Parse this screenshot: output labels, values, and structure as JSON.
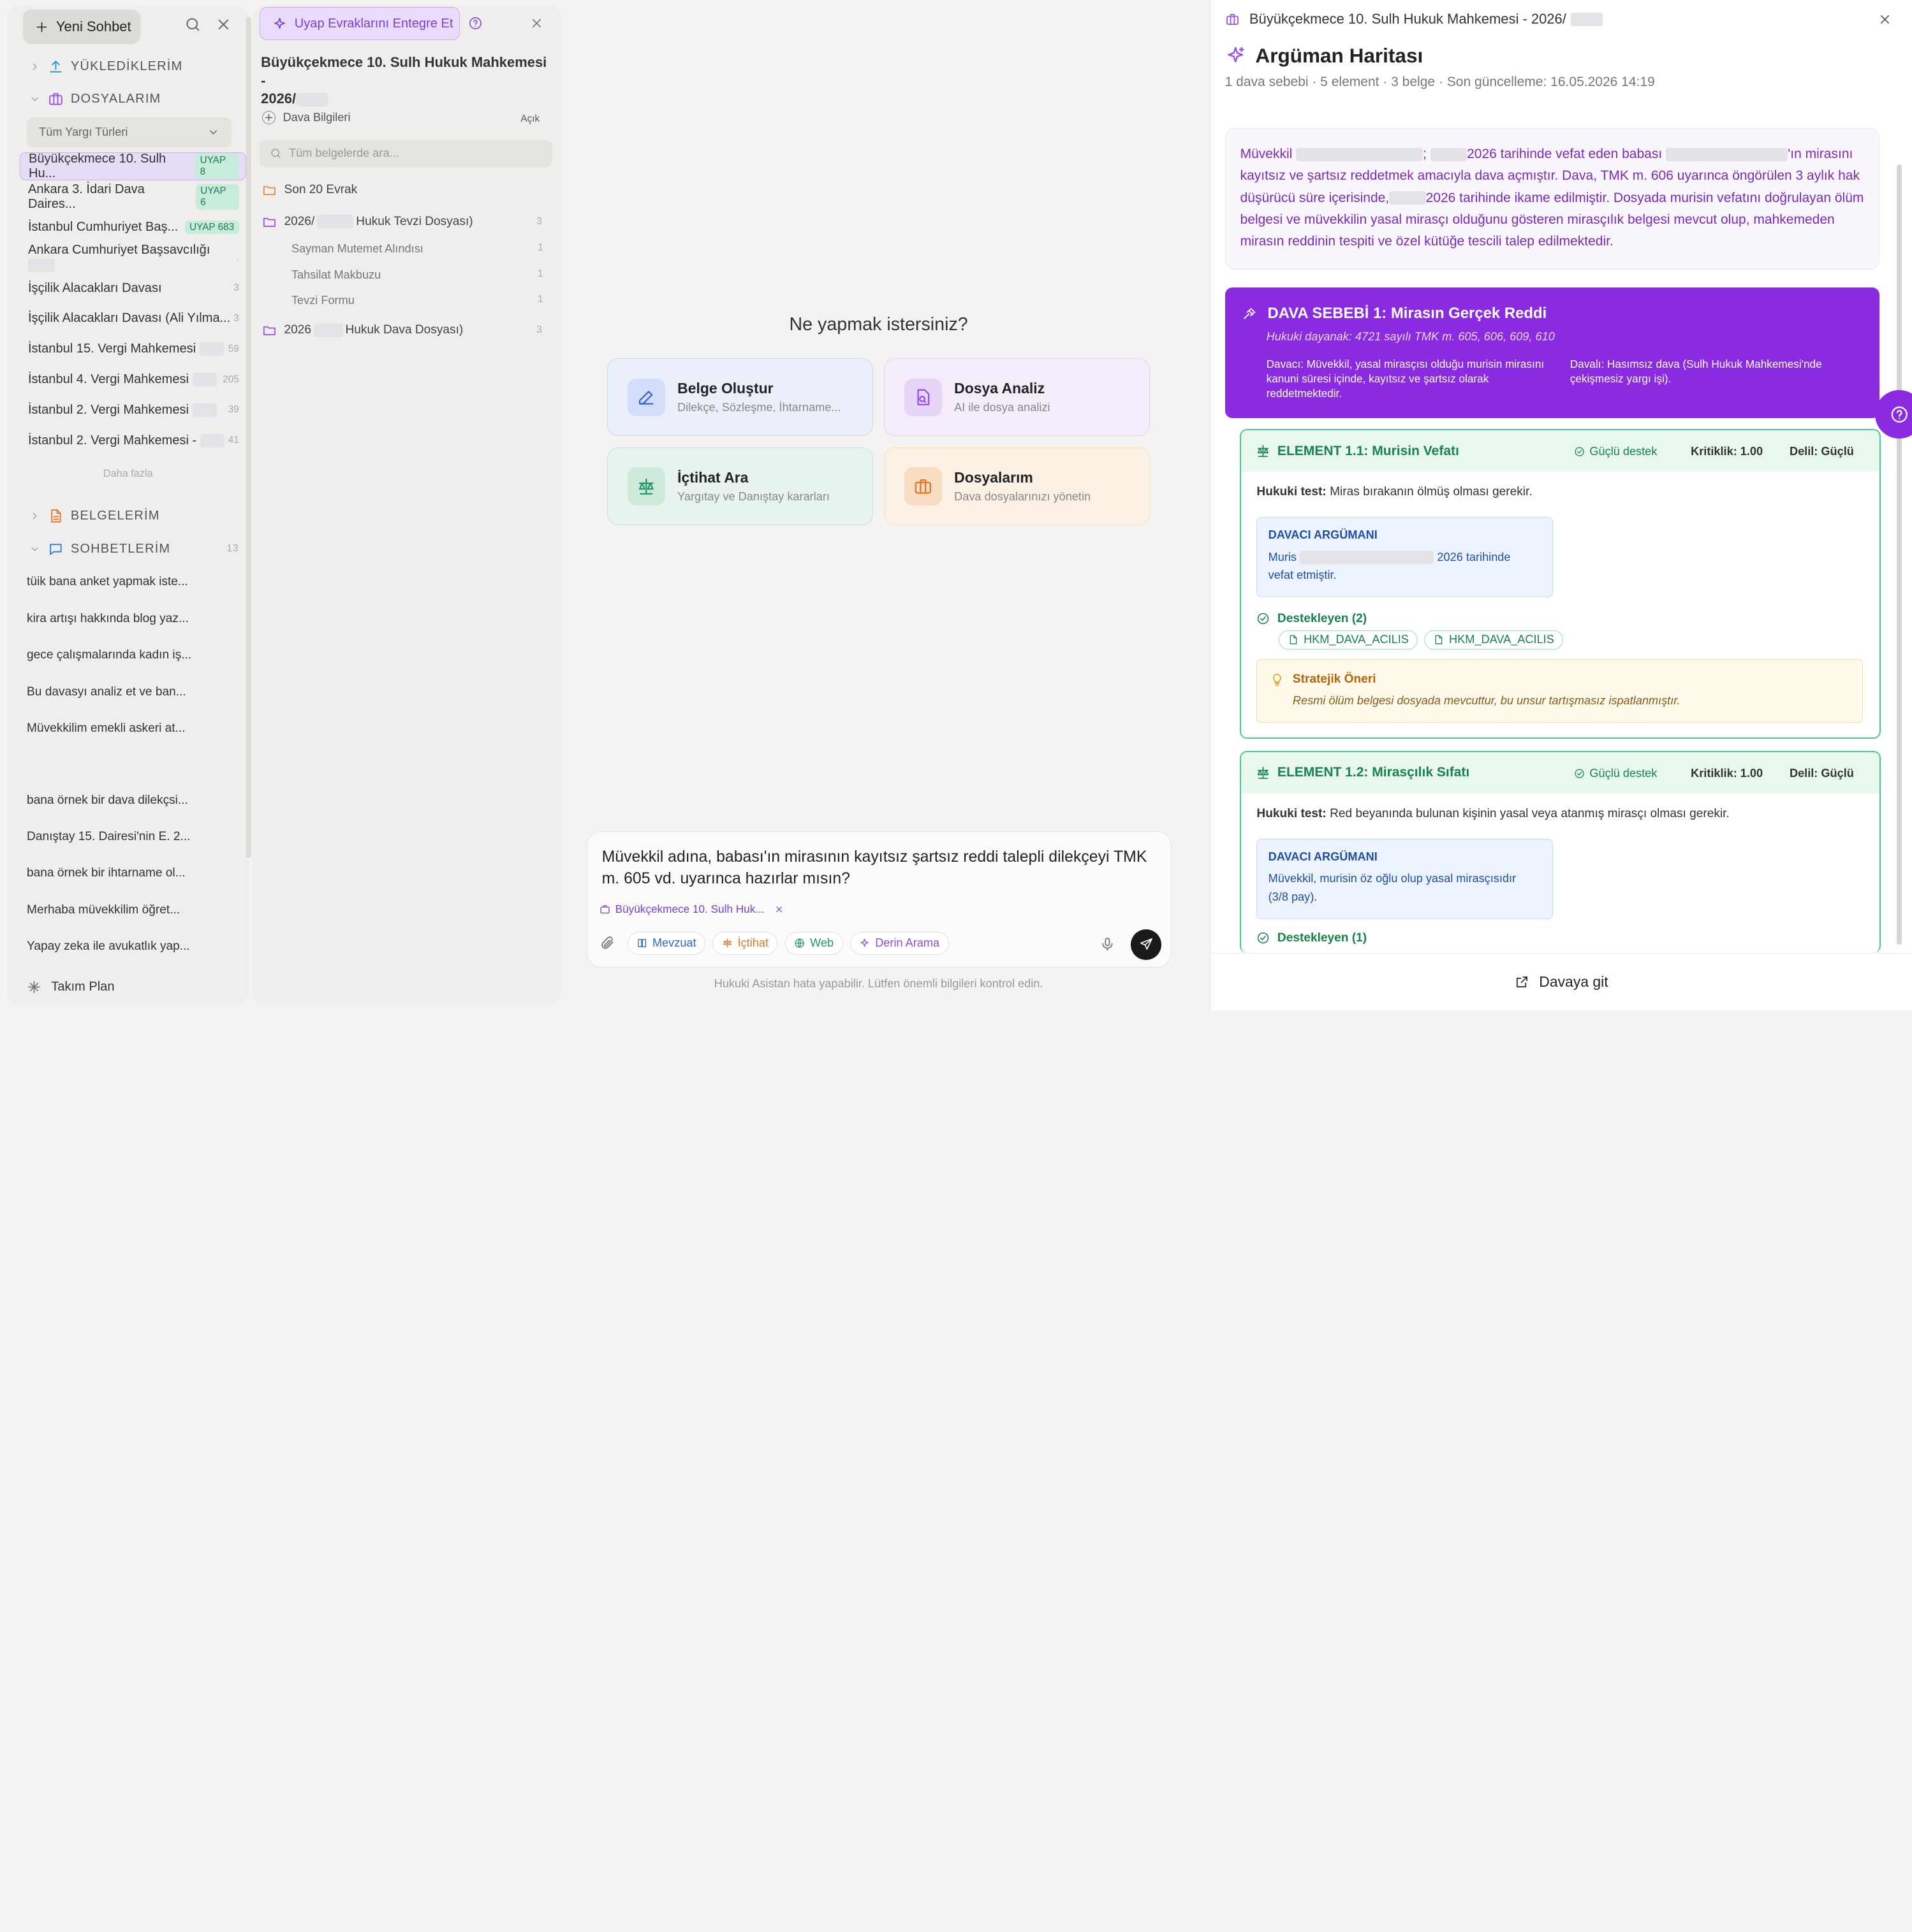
{
  "sidebar": {
    "new_chat": "Yeni Sohbet",
    "uploads": "YÜKLEDİKLERİM",
    "cases": "DOSYALARIM",
    "filter": "Tüm Yargı Türleri",
    "case_items": [
      {
        "label": "Büyükçekmece 10. Sulh Hu...",
        "badge": "UYAP 8"
      },
      {
        "label": "Ankara 3. İdari Dava Daires...",
        "badge": "UYAP 6"
      },
      {
        "label": "İstanbul Cumhuriyet Baş...",
        "badge": "UYAP 683"
      },
      {
        "label": "Ankara Cumhuriyet Başsavcılığı",
        "count": ""
      },
      {
        "label": "İşçilik Alacakları Davası",
        "count": "3"
      },
      {
        "label": "İşçilik Alacakları Davası (Ali Yılma...",
        "count": "3"
      },
      {
        "label": "İstanbul 15. Vergi Mahkemesi",
        "count": "59"
      },
      {
        "label": "İstanbul 4. Vergi Mahkemesi",
        "count": "205"
      },
      {
        "label": "İstanbul 2. Vergi Mahkemesi",
        "count": "39"
      },
      {
        "label": "İstanbul 2. Vergi Mahkemesi -",
        "count": "41"
      }
    ],
    "more": "Daha fazla",
    "documents": "BELGELERİM",
    "chats_title": "SOHBETLERİM",
    "chats_count": "13",
    "chats": [
      "tüik bana anket yapmak iste...",
      "kira artışı hakkında blog yaz...",
      "gece çalışmalarında kadın iş...",
      "Bu davasyı analiz et ve ban...",
      "Müvekkilim emekli askeri at...",
      "bana örnek bir dava dilekçsi...",
      "Danıştay 15. Dairesi'nin E. 2...",
      "bana örnek bir ihtarname ol...",
      "Merhaba müvekkilim öğret...",
      "Yapay zeka ile avukatlık yap..."
    ],
    "team_plan": "Takım Plan"
  },
  "panel2": {
    "uyap_button": "Uyap Evraklarını Entegre Et",
    "case_title_1": "Büyükçekmece 10. Sulh Hukuk Mahkemesi -",
    "case_title_2": "2026/",
    "case_info": "Dava Bilgileri",
    "case_info_toggle": "Açık",
    "search_placeholder": "Tüm belgelerde ara...",
    "recent": "Son 20 Evrak",
    "folder1_a": "2026/",
    "folder1_b": "Hukuk Tevzi Dosyası)",
    "folder1_count": "3",
    "files": [
      {
        "name": "Sayman Mutemet Alındısı",
        "count": "1"
      },
      {
        "name": "Tahsilat Makbuzu",
        "count": "1"
      },
      {
        "name": "Tevzi Formu",
        "count": "1"
      }
    ],
    "folder2_a": "2026",
    "folder2_b": "Hukuk Dava Dosyası)",
    "folder2_count": "3"
  },
  "center": {
    "question": "Ne yapmak istersiniz?",
    "cards": [
      {
        "title": "Belge Oluştur",
        "sub": "Dilekçe, Sözleşme, İhtarname..."
      },
      {
        "title": "Dosya Analiz",
        "sub": "AI ile dosya analizi"
      },
      {
        "title": "İçtihat Ara",
        "sub": "Yargıtay ve Danıştay kararları"
      },
      {
        "title": "Dosyalarım",
        "sub": "Dava dosyalarınızı yönetin"
      }
    ],
    "message": "Müvekkil  adına, babası'ın mirasının kayıtsız şartsız reddi talepli dilekçeyi TMK m. 605 vd. uyarınca hazırlar mısın?",
    "attached_case": "Büyükçekmece 10. Sulh Huk...",
    "tools": [
      "Mevzuat",
      "İçtihat",
      "Web",
      "Derin Arama"
    ],
    "disclaimer": "Hukuki Asistan hata yapabilir. Lütfen önemli bilgileri kontrol edin."
  },
  "right": {
    "window_title": "Büyükçekmece 10. Sulh Hukuk Mahkemesi - 2026/",
    "title": "Argüman Haritası",
    "meta": "1 dava sebebi · 5 element · 3 belge · Son güncelleme: 16.05.2026 14:19",
    "summary": {
      "p1": "Müvekkil",
      "p2": ";",
      "p3": "2026 tarihinde vefat eden babası",
      "p4": "'ın mirasını kayıtsız ve şartsız reddetmek amacıyla dava açmıştır. Dava, TMK m. 606 uyarınca öngörülen 3 aylık hak düşürücü süre içerisinde,",
      "p5": "2026 tarihinde ikame edilmiştir. Dosyada murisin vefatını doğrulayan ölüm belgesi ve müvekkilin yasal mirasçı olduğunu gösteren mirasçılık belgesi mevcut olup, mahkemeden mirasın reddinin tespiti ve özel kütüğe tescili talep edilmektedir."
    },
    "cause": {
      "title": "DAVA SEBEBİ 1: Mirasın Gerçek Reddi",
      "basis": "Hukuki dayanak: 4721 sayılı TMK m. 605, 606, 609, 610",
      "plaintiff": "Davacı: Müvekkil, yasal mirasçısı olduğu murisin mirasını kanuni süresi içinde, kayıtsız ve şartsız olarak reddetmektedir.",
      "defendant": "Davalı: Hasımsız dava (Sulh Hukuk Mahkemesi'nde çekişmesiz yargı işi)."
    },
    "elements": [
      {
        "title": "ELEMENT 1.1: Murisin Vefatı",
        "support": "Güçlü destek",
        "criticality": "Kritiklik: 1.00",
        "evidence": "Delil: Güçlü",
        "test_label": "Hukuki test:",
        "test": "Miras bırakanın ölmüş olması gerekir.",
        "arg_title": "DAVACI ARGÜMANI",
        "arg_a": "Muris",
        "arg_b": "2026 tarihinde",
        "arg_c": "vefat etmiştir.",
        "supporting": "Destekleyen (2)",
        "docs": [
          "HKM_DAVA_ACILIS",
          "HKM_DAVA_ACILIS"
        ],
        "strategy_title": "Stratejik Öneri",
        "strategy": "Resmi ölüm belgesi dosyada mevcuttur, bu unsur tartışmasız ispatlanmıştır."
      },
      {
        "title": "ELEMENT 1.2: Mirasçılık Sıfatı",
        "support": "Güçlü destek",
        "criticality": "Kritiklik: 1.00",
        "evidence": "Delil: Güçlü",
        "test_label": "Hukuki test:",
        "test": "Red beyanında bulunan kişinin yasal veya atanmış mirasçı olması gerekir.",
        "arg_title": "DAVACI ARGÜMANI",
        "arg_a": "Müvekkil, murisin öz oğlu olup yasal mirasçısıdır",
        "arg_c": "(3/8 pay).",
        "supporting": "Destekleyen (1)"
      }
    ],
    "go_case": "Davaya git"
  }
}
